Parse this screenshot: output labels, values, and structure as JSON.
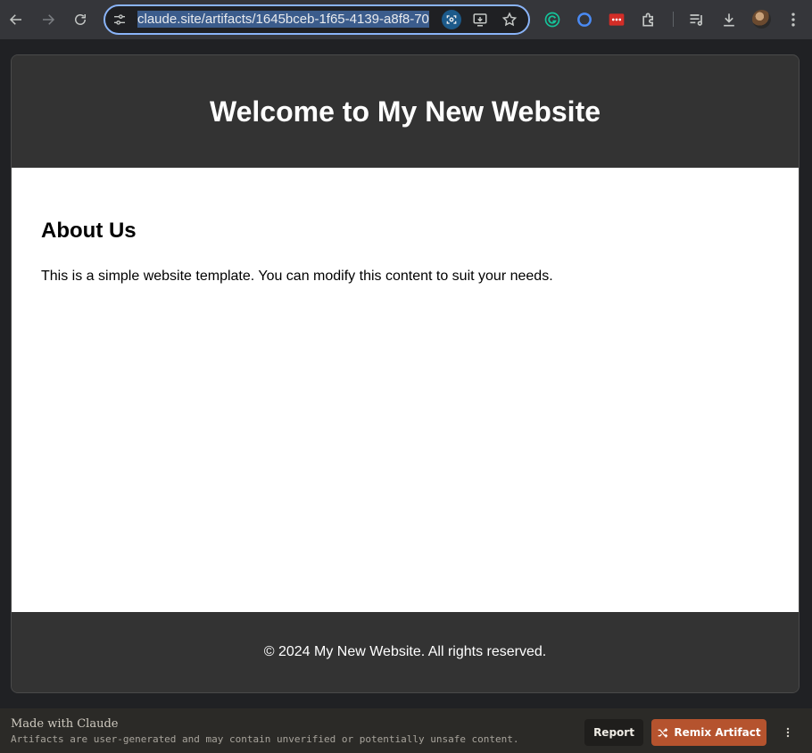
{
  "browser": {
    "url": "claude.site/artifacts/1645bceb-1f65-4139-a8f8-70",
    "icons": {
      "back": "arrow-left-icon",
      "forward": "arrow-right-icon",
      "reload": "reload-icon",
      "site_settings": "tune-icon",
      "lens": "google-lens-icon",
      "install": "install-app-icon",
      "bookmark": "star-icon",
      "extensions": [
        "grammarly-icon",
        "blue-circle-extension-icon",
        "lastpass-icon",
        "puzzle-extensions-icon"
      ],
      "media": "media-queue-icon",
      "download": "download-icon",
      "menu": "kebab-menu-icon"
    }
  },
  "site": {
    "header_title": "Welcome to My New Website",
    "section_title": "About Us",
    "section_text": "This is a simple website template. You can modify this content to suit your needs.",
    "footer_text": "© 2024 My New Website. All rights reserved."
  },
  "artifact_bar": {
    "made_with": "Made with Claude",
    "disclaimer": "Artifacts are user-generated and may contain unverified or potentially unsafe content.",
    "report_label": "Report",
    "remix_label": "Remix Artifact"
  },
  "colors": {
    "toolbar": "#35363a",
    "omnibox_focus": "#8ab4f8",
    "site_dark": "#333333",
    "remix_accent": "#b5532e"
  }
}
